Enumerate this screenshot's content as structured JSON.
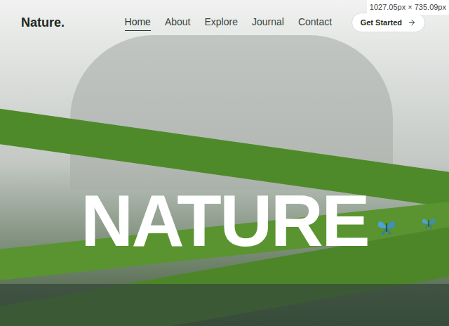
{
  "logo": "Nature.",
  "nav": [
    {
      "label": "Home",
      "selected": true
    },
    {
      "label": "About",
      "selected": false
    },
    {
      "label": "Explore",
      "selected": false
    },
    {
      "label": "Journal",
      "selected": false
    },
    {
      "label": "Contact",
      "selected": false
    }
  ],
  "cta": {
    "label": "Get Started"
  },
  "hero": {
    "title": "NATURE"
  },
  "dimension_badge": "1027.05px × 735.09px"
}
